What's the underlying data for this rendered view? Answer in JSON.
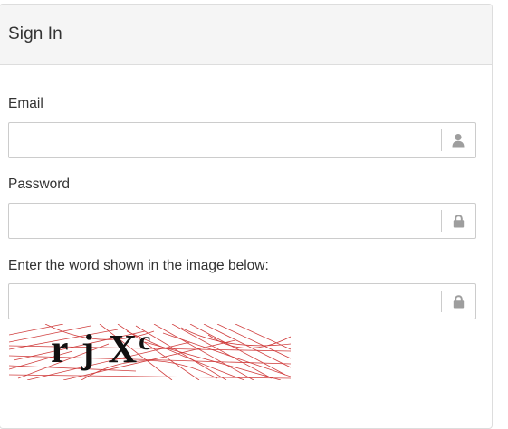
{
  "panel": {
    "title": "Sign In"
  },
  "form": {
    "email": {
      "label": "Email",
      "value": "",
      "icon": "user-icon"
    },
    "password": {
      "label": "Password",
      "value": "",
      "icon": "lock-icon"
    },
    "captcha": {
      "label": "Enter the word shown in the image below:",
      "value": "",
      "icon": "lock-icon",
      "image_text_main": "r j X",
      "image_text_super": "c"
    }
  },
  "colors": {
    "heading_bg": "#f5f5f5",
    "border": "#cccccc",
    "icon": "#9e9e9e",
    "captcha_noise": "#cc2a2a"
  }
}
